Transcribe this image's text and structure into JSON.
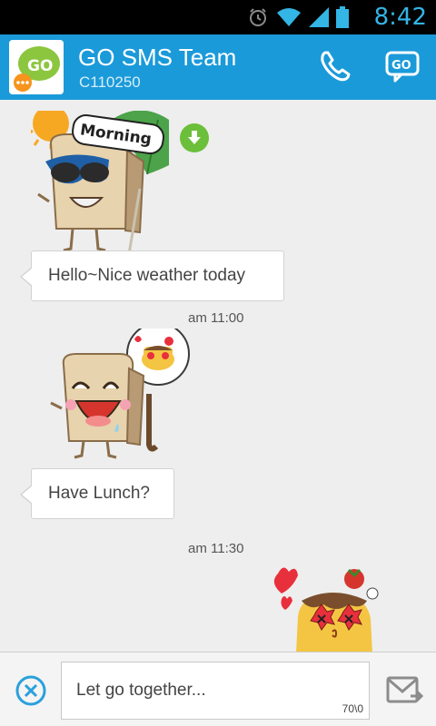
{
  "status_bar": {
    "time": "8:42",
    "icons": [
      "alarm-icon",
      "wifi-icon",
      "signal-icon",
      "battery-icon"
    ]
  },
  "header": {
    "title": "GO SMS Team",
    "subtitle": "C110250",
    "avatar_icon": "go-sms-logo",
    "actions": [
      "phone-icon",
      "go-chat-icon"
    ],
    "colors": {
      "bar": "#1b9ad9"
    }
  },
  "messages": {
    "sticker1": {
      "text": "Morning",
      "icon": "morning-toast-sticker"
    },
    "msg1": "Hello~Nice weather today",
    "time1": "am 11:00",
    "sticker2": {
      "icon": "laughing-toast-sticker"
    },
    "msg2": "Have Lunch?",
    "time2": "am 11:30",
    "sticker3": {
      "icon": "pudding-love-sticker"
    }
  },
  "composer": {
    "value": "Let go together...",
    "counter": "70\\0",
    "clear_icon": "close-circle-icon",
    "send_icon": "send-mail-icon"
  }
}
